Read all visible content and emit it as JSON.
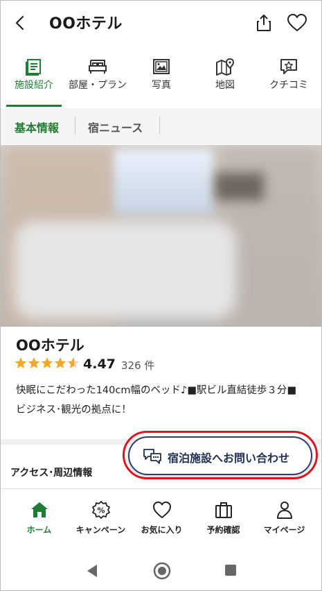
{
  "header": {
    "title": "OOホテル",
    "back_icon": "chevron-left-icon",
    "share_icon": "share-icon",
    "favorite_icon": "heart-icon"
  },
  "tabs": [
    {
      "label": "施設紹介",
      "icon": "document-icon",
      "active": true
    },
    {
      "label": "部屋・プラン",
      "icon": "bed-icon",
      "active": false
    },
    {
      "label": "写真",
      "icon": "image-icon",
      "active": false
    },
    {
      "label": "地図",
      "icon": "map-pin-icon",
      "active": false
    },
    {
      "label": "クチコミ",
      "icon": "review-star-bubble-icon",
      "active": false
    }
  ],
  "subtabs": [
    {
      "label": "基本情報",
      "active": true
    },
    {
      "label": "宿ニュース",
      "active": false
    }
  ],
  "hotel": {
    "name": "OOホテル",
    "rating": "4.47",
    "rating_value": 4.47,
    "review_count": "326 件",
    "description": "快眠にこだわった140cm幅のベッド♪■駅ビル直結徒歩３分■ビジネス･観光の拠点に！"
  },
  "section": {
    "access_label": "アクセス･周辺情報"
  },
  "contact_button": {
    "label": "宿泊施設へお問い合わせ",
    "icon": "chat-bubbles-icon"
  },
  "bottom_nav": [
    {
      "label": "ホーム",
      "icon": "home-icon",
      "active": true
    },
    {
      "label": "キャンペーン",
      "icon": "percent-badge-icon",
      "active": false
    },
    {
      "label": "お気に入り",
      "icon": "heart-icon",
      "active": false
    },
    {
      "label": "予約確認",
      "icon": "luggage-icon",
      "active": false
    },
    {
      "label": "マイページ",
      "icon": "person-icon",
      "active": false
    }
  ],
  "colors": {
    "accent_green": "#1e7d32",
    "star": "#f5a623",
    "highlight_red": "#e0141f",
    "button_navy": "#2b3f6b"
  }
}
